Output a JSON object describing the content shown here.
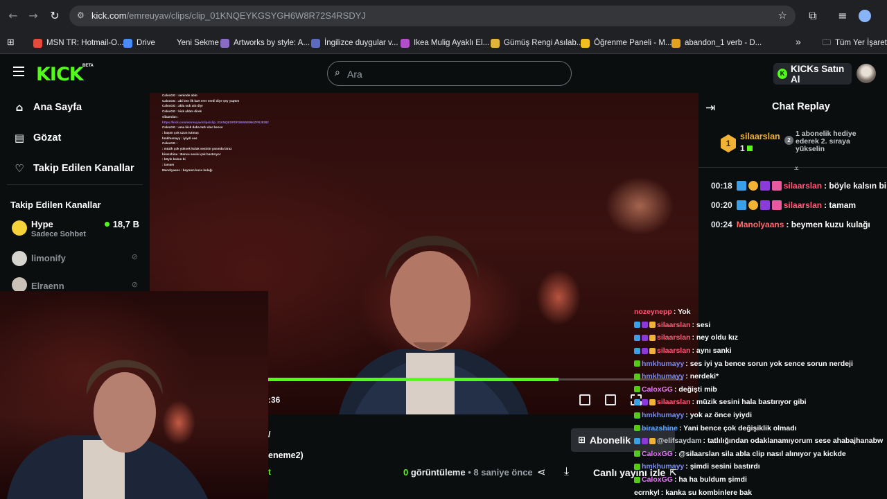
{
  "browser": {
    "url_main": "kick.com",
    "url_rest": "/emreuyav/clips/clip_01KNQEYKGSYGH6W8R72S4RSDYJ",
    "bookmarks": [
      {
        "label": "MSN TR: Hotmail-O...",
        "color": "#e34b3c"
      },
      {
        "label": "Drive",
        "color": "#4a8af4"
      },
      {
        "label": "Yeni Sekme",
        "color": "#202124"
      },
      {
        "label": "Artworks by style: A...",
        "color": "#8a6cc4"
      },
      {
        "label": "İngilizce duygular v...",
        "color": "#5c6bc0"
      },
      {
        "label": "Ikea Mulig Ayaklı El...",
        "color": "#b04fc9"
      },
      {
        "label": "Gümüş Rengi Asılab...",
        "color": "#e0b53a"
      },
      {
        "label": "Öğrenme Paneli - M...",
        "color": "#f0c020"
      },
      {
        "label": "abandon_1 verb - D...",
        "color": "#e4a020"
      }
    ],
    "all_bookmarks": "Tüm Yer İşaretleri"
  },
  "header": {
    "logo": "KICK",
    "beta": "BETA",
    "search_placeholder": "Ara",
    "kicks_label": "KICKs Satın Al"
  },
  "sidebar": {
    "nav": [
      {
        "label": "Ana Sayfa",
        "icon": "home-icon"
      },
      {
        "label": "Gözat",
        "icon": "browse-icon"
      },
      {
        "label": "Takip Edilen Kanallar",
        "icon": "heart-icon"
      }
    ],
    "followed_title": "Takip Edilen Kanallar",
    "channels": [
      {
        "name": "Hype",
        "sub": "Sadece Sohbet",
        "viewers": "18,7 B",
        "live": true
      },
      {
        "name": "limonify",
        "live": false
      },
      {
        "name": "Elraenn",
        "live": false
      }
    ]
  },
  "video": {
    "time": ":36",
    "progress": 0.7,
    "stream_chat": [
      "CaloxGG : seninde ablo",
      "CaloxGG : abi ben ilk kart erer verdi diye şey yaptım",
      "CaloxGG : abla sub attı diyr",
      "CaloxGG : kick aldım direk",
      "silaarslan :",
      "https://kick.com/emreuyav/clips/clip_01KNQESPDF3I6WW89KZFRJ8382",
      "CaloxGG : ama kick daha tarlı olur bence",
      "         : başım çok uzun tutmuş",
      "hmkhumayy : iyiydi ses",
      "CaloxGG :",
      "         : müzik çok yüksek kulak sesinin yanında biraz",
      "birazshine : Bence sesini çok bastırıyor",
      "         : böyle kalsın bi",
      "         : tamam",
      "Manolyaans : beymen kuzu kulağı"
    ]
  },
  "chat_replay": {
    "title": "Chat Replay",
    "pinned": {
      "badge": "1",
      "user": "silaarslan",
      "count": "1",
      "rank": "2",
      "text": "1 abonelik hediye ederek 2. sıraya yükselin"
    },
    "messages": [
      {
        "time": "00:18",
        "user": "silaarslan",
        "user_color": "#ff5c7a",
        "text": "böyle kalsın bi",
        "badges": true
      },
      {
        "time": "00:20",
        "user": "silaarslan",
        "user_color": "#ff5c7a",
        "text": "tamam",
        "badges": true
      },
      {
        "time": "00:24",
        "user": "Manolyaans",
        "user_color": "#ff6a6a",
        "text": "beymen kuzu kulağı",
        "badges": false
      }
    ]
  },
  "overlay_chat": [
    {
      "user": "nozeynepp",
      "color": "#ff5c7a",
      "text": "Yok",
      "badges": ""
    },
    {
      "user": "silaarslan",
      "color": "#ff5c7a",
      "text": "sesi",
      "badges": "sub"
    },
    {
      "user": "silaarslan",
      "color": "#ff5c7a",
      "text": "ney oldu kız",
      "badges": "sub"
    },
    {
      "user": "silaarslan",
      "color": "#ff5c7a",
      "text": "aynı sanki",
      "badges": "sub"
    },
    {
      "user": "hmkhumayy",
      "color": "#7b8cff",
      "text": "ses iyi ya bence sorun yok sence sorun nerdeji",
      "badges": "g"
    },
    {
      "user": "hmkhumayy",
      "color": "#7b8cff",
      "text": "nerdeki*",
      "badges": "g"
    },
    {
      "user": "CaloxGG",
      "color": "#e879f9",
      "text": "değişti mib",
      "badges": "g"
    },
    {
      "user": "silaarslan",
      "color": "#ff5c7a",
      "text": "müzik sesini hala bastırıyor gibi",
      "badges": "sub"
    },
    {
      "user": "hmkhumayy",
      "color": "#7b8cff",
      "text": "yok az önce iyiydi",
      "badges": "g"
    },
    {
      "user": "birazshine",
      "color": "#5aa8ff",
      "text": "Yani bence çok değişiklik olmadı",
      "badges": "g"
    },
    {
      "user": "@elifsaydam",
      "color": "#c7c9cc",
      "text": "tatlılığından odaklanamıyorum sese ahabajhanabw",
      "badges": "sub"
    },
    {
      "user": "CaloxGG",
      "color": "#e879f9",
      "text": "@silaarslan sila abla clip nasıl alınıyor ya kickde",
      "badges": "g"
    },
    {
      "user": "hmkhumayy",
      "color": "#7b8cff",
      "text": "şimdi sesini bastırdı",
      "badges": "g"
    },
    {
      "user": "CaloxGG",
      "color": "#e879f9",
      "text": "ha ha buldum şimdi",
      "badges": "g"
    },
    {
      "user": "ecrnkyl",
      "color": "#ffffff",
      "text": "kanka su kombinlere bak",
      "badges": ""
    }
  ],
  "below_video": {
    "subscribe": "Abonelik",
    "clip_title": "eneme2)",
    "views_count": "0",
    "views_label": "görüntüleme",
    "time_ago": "• 8 saniye önce",
    "watch_live": "Canlı yayını izle"
  }
}
